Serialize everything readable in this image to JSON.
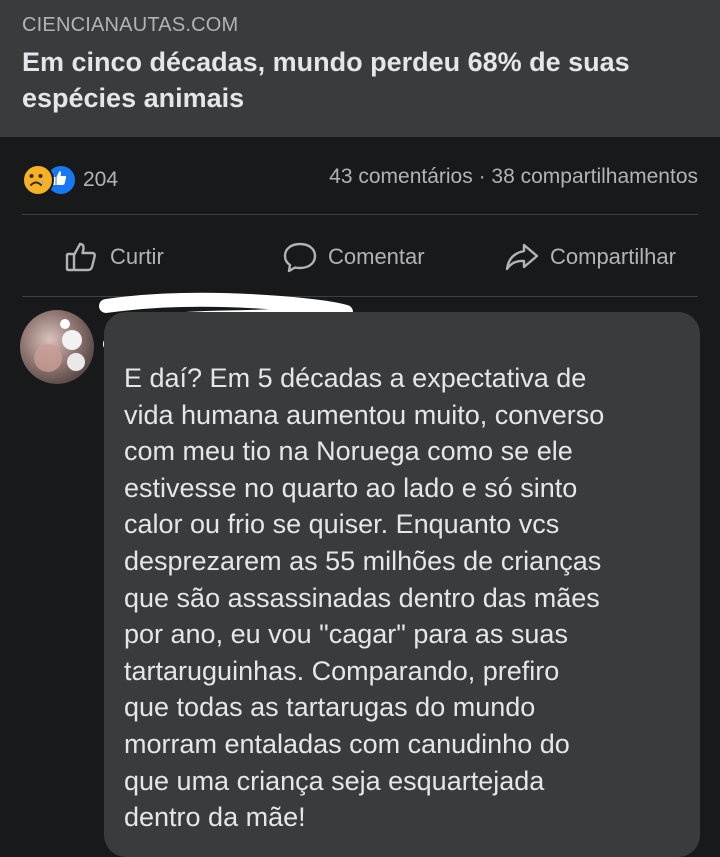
{
  "link": {
    "domain": "CIENCIANAUTAS.COM",
    "title": "Em cinco décadas, mundo perdeu 68% de suas espécies animais"
  },
  "stats": {
    "reactions": [
      "sad-reaction-icon",
      "like-reaction-icon"
    ],
    "reaction_count": "204",
    "comments_shares": "43 comentários · 38 compartilhamentos"
  },
  "actions": {
    "like": "Curtir",
    "comment": "Comentar",
    "share": "Compartilhar"
  },
  "comment": {
    "text": "E daí? Em 5 décadas a expectativa de\nvida humana aumentou muito, converso\ncom meu tio na Noruega como se ele\nestivesse no quarto ao lado e só sinto\ncalor ou frio se quiser. Enquanto vcs\ndesprezarem as 55 milhões de crianças\nque são assassinadas dentro das mães\npor ano, eu vou \"cagar\" para as suas\ntartaruguinhas. Comparando, prefiro\nque todas as tartarugas do mundo\nmorram entaladas com canudinho do\nque uma criança seja esquartejada\ndentro da mãe!"
  },
  "colors": {
    "background": "#18191a",
    "card": "#3a3b3c",
    "text_primary": "#e4e6eb",
    "text_secondary": "#b0b3b8",
    "like_blue": "#1877f2",
    "sad_yellow": "#f7b125"
  }
}
